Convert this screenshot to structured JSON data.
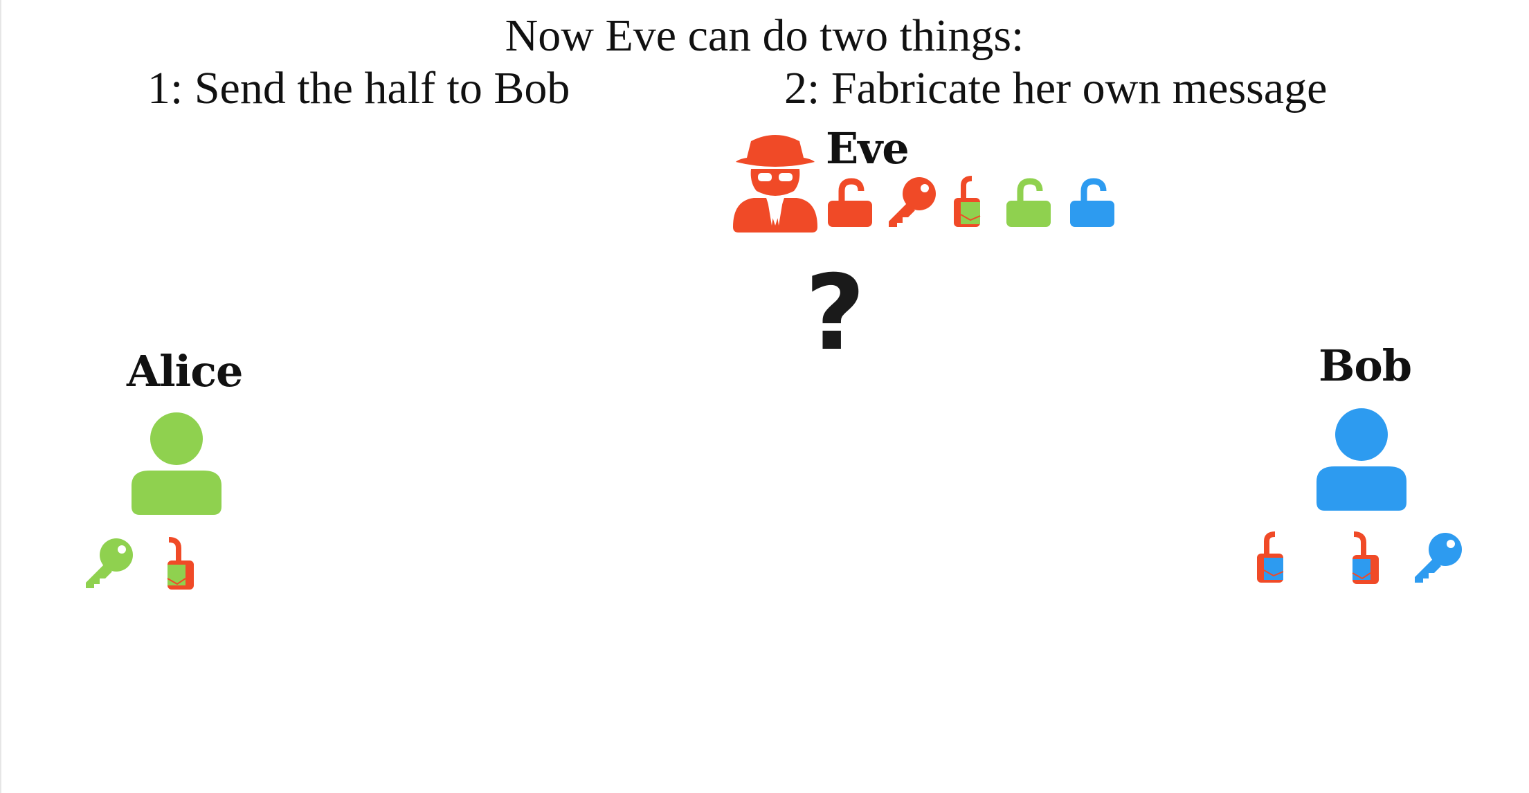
{
  "heading": "Now Eve can do two things:",
  "options": [
    "1: Send the half to Bob",
    "2: Fabricate her own message"
  ],
  "question_mark": "?",
  "colors": {
    "eve": "#f04a27",
    "alice": "#8fd14f",
    "bob": "#2d9bf0",
    "text": "#111111"
  },
  "eve": {
    "name": "Eve",
    "icons": [
      "spy-icon",
      "red-open-lock-icon",
      "red-key-icon",
      "red-half-lock-with-green-message-icon",
      "green-open-lock-icon",
      "blue-open-lock-icon"
    ]
  },
  "alice": {
    "name": "Alice",
    "icons": [
      "user-icon",
      "green-key-icon",
      "red-half-lock-with-green-message-icon"
    ]
  },
  "bob": {
    "name": "Bob",
    "icons": [
      "user-icon",
      "red-half-lock-with-blue-message-icon",
      "red-half-lock-with-blue-message-icon",
      "blue-key-icon"
    ]
  }
}
